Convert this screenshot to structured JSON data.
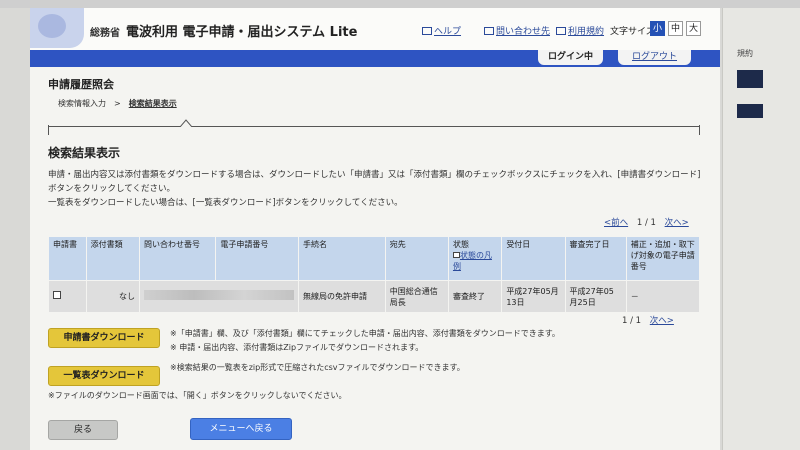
{
  "header": {
    "ministry": "総務省",
    "title": "電波利用 電子申請・届出システム Lite",
    "links": {
      "help": "ヘルプ",
      "contact": "問い合わせ先",
      "terms": "利用規約"
    },
    "fontsize_label": "文字サイズ:",
    "fontsize_options": [
      "小",
      "中",
      "大"
    ],
    "fontsize_selected": "小"
  },
  "login": {
    "status": "ログイン中",
    "logout": "ログアウト"
  },
  "right_fragment": "規約",
  "section_title": "申請履歴照会",
  "breadcrumb": {
    "step1": "検索情報入力",
    "sep": ">",
    "step2": "検索結果表示"
  },
  "main": {
    "heading": "検索結果表示",
    "desc1": "申請・届出内容又は添付書類をダウンロードする場合は、ダウンロードしたい「申請書」又は「添付書類」欄のチェックボックスにチェックを入れ、[申請書ダウンロード]",
    "desc2": "ボタンをクリックしてください。",
    "desc3": "一覧表をダウンロードしたい場合は、[一覧表ダウンロード]ボタンをクリックしてください。"
  },
  "pager": {
    "prev": "<前へ",
    "page": "1 / 1",
    "next": "次へ>"
  },
  "table": {
    "headers": [
      "申請書",
      "添付書類",
      "問い合わせ番号",
      "電子申請番号",
      "手続名",
      "宛先",
      "状態",
      "受付日",
      "審査完了日",
      "補正・追加・取下げ対象の電子申請番号"
    ],
    "state_legend": "状態の凡例",
    "row": {
      "attachment": "なし",
      "procedure": "無線局の免許申請",
      "destination": "中国総合通信局長",
      "state": "審査終了",
      "received": "平成27年05月13日",
      "completed": "平成27年05月25日",
      "amend": "－"
    }
  },
  "actions": {
    "app_download": "申請書ダウンロード",
    "app_note1": "※「申請書」欄、及び「添付書類」欄にてチェックした申請・届出内容、添付書類をダウンロードできます。",
    "app_note2": "※ 申請・届出内容、添付書類はZipファイルでダウンロードされます。",
    "list_download": "一覧表ダウンロード",
    "list_note": "※検索結果の一覧表をzip形式で圧縮されたcsvファイルでダウンロードできます。",
    "open_note": "※ファイルのダウンロード画面では、「開く」ボタンをクリックしないでください。",
    "back": "戻る",
    "menu": "メニューへ戻る"
  },
  "colors": {
    "accent_blue": "#2e54c2",
    "header_cell": "#c4d6ec",
    "yellow_button": "#e4c63a",
    "blue_button": "#4b7fe4"
  }
}
